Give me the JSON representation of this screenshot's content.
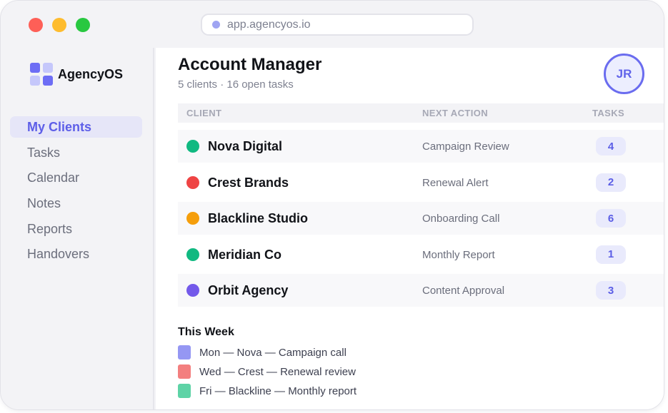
{
  "browser": {
    "url": "app.agencyos.io"
  },
  "sidebar": {
    "brand": "AgencyOS",
    "items": [
      {
        "label": "My Clients",
        "active": true
      },
      {
        "label": "Tasks",
        "active": false
      },
      {
        "label": "Calendar",
        "active": false
      },
      {
        "label": "Notes",
        "active": false
      },
      {
        "label": "Reports",
        "active": false
      },
      {
        "label": "Handovers",
        "active": false
      }
    ]
  },
  "header": {
    "title": "Account Manager",
    "subtitle": "5 clients · 16 open tasks",
    "avatar_initials": "JR"
  },
  "table": {
    "columns": {
      "client": "CLIENT",
      "next_action": "NEXT ACTION",
      "tasks": "TASKS"
    },
    "rows": [
      {
        "client": "Nova Digital",
        "status_color": "#10b981",
        "next_action": "Campaign Review",
        "tasks": "4"
      },
      {
        "client": "Crest Brands",
        "status_color": "#ef4444",
        "next_action": "Renewal Alert",
        "tasks": "2"
      },
      {
        "client": "Blackline Studio",
        "status_color": "#f59e0b",
        "next_action": "Onboarding Call",
        "tasks": "6"
      },
      {
        "client": "Meridian Co",
        "status_color": "#10b981",
        "next_action": "Monthly Report",
        "tasks": "1"
      },
      {
        "client": "Orbit Agency",
        "status_color": "#7359ea",
        "next_action": "Content Approval",
        "tasks": "3"
      }
    ]
  },
  "this_week": {
    "title": "This Week",
    "items": [
      {
        "text": "Mon — Nova — Campaign call",
        "color": "#9597f3"
      },
      {
        "text": "Wed — Crest — Renewal review",
        "color": "#f37f7f"
      },
      {
        "text": "Fri — Blackline — Monthly report",
        "color": "#5ed3a6"
      }
    ]
  },
  "colors": {
    "accent": "#5d5ee8"
  }
}
